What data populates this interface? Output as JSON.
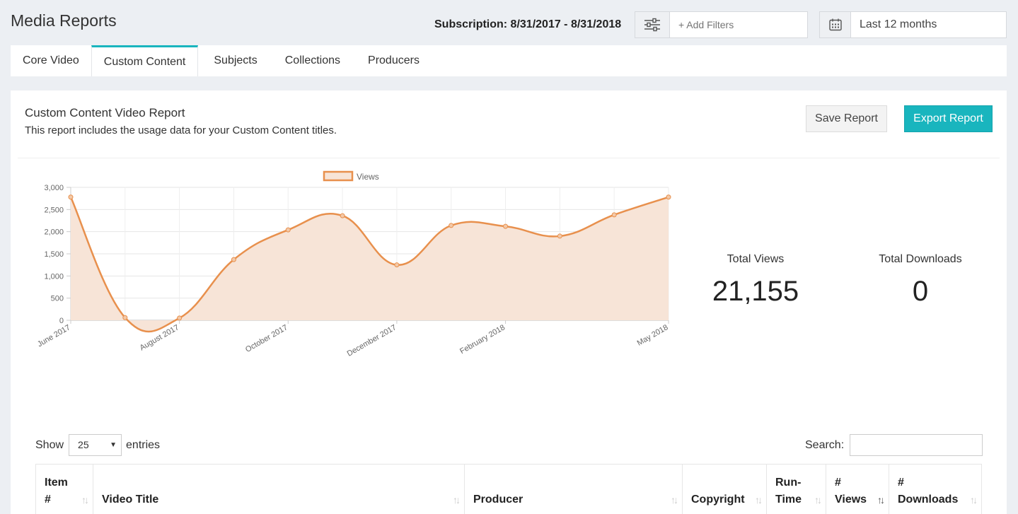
{
  "header": {
    "title": "Media Reports",
    "subscription": "Subscription: 8/31/2017 - 8/31/2018",
    "filters_placeholder": "+ Add Filters",
    "date_range": "Last 12 months"
  },
  "tabs": [
    {
      "label": "Core Video"
    },
    {
      "label": "Custom Content"
    },
    {
      "label": "Subjects"
    },
    {
      "label": "Collections"
    },
    {
      "label": "Producers"
    }
  ],
  "active_tab": "Custom Content",
  "report": {
    "title": "Custom Content Video Report",
    "description": "This report includes the usage data for your Custom Content titles.",
    "save_label": "Save Report",
    "export_label": "Export Report"
  },
  "stats": {
    "views_label": "Total Views",
    "views_value": "21,155",
    "downloads_label": "Total Downloads",
    "downloads_value": "0"
  },
  "chart_data": {
    "type": "area",
    "legend": "Views",
    "legend_position": "top",
    "grid": true,
    "x": [
      "June 2017",
      "July 2017",
      "August 2017",
      "September 2017",
      "October 2017",
      "November 2017",
      "December 2017",
      "January 2018",
      "February 2018",
      "March 2018",
      "April 2018",
      "May 2018"
    ],
    "x_tick_labels": [
      "June 2017",
      "August 2017",
      "October 2017",
      "December 2017",
      "February 2018",
      "May 2018"
    ],
    "values": [
      2780,
      60,
      50,
      1370,
      2040,
      2360,
      1250,
      2140,
      2120,
      1900,
      2380,
      2780
    ],
    "y_ticks": [
      "0",
      "500",
      "1,000",
      "1,500",
      "2,000",
      "2,500",
      "3,000"
    ],
    "ylim": [
      0,
      3000
    ],
    "color": "#e8904d",
    "fill": "#f7e4d7"
  },
  "table_controls": {
    "show_label": "Show",
    "entries_value": "25",
    "entries_label": "entries",
    "search_label": "Search:"
  },
  "table": {
    "columns": [
      {
        "line1": "Item",
        "line2": "#"
      },
      {
        "line1": "",
        "line2": "Video Title"
      },
      {
        "line1": "",
        "line2": "Producer"
      },
      {
        "line1": "",
        "line2": "Copyright"
      },
      {
        "line1": "Run-",
        "line2": "Time"
      },
      {
        "line1": "#",
        "line2": "Views"
      },
      {
        "line1": "#",
        "line2": "Downloads"
      }
    ]
  }
}
